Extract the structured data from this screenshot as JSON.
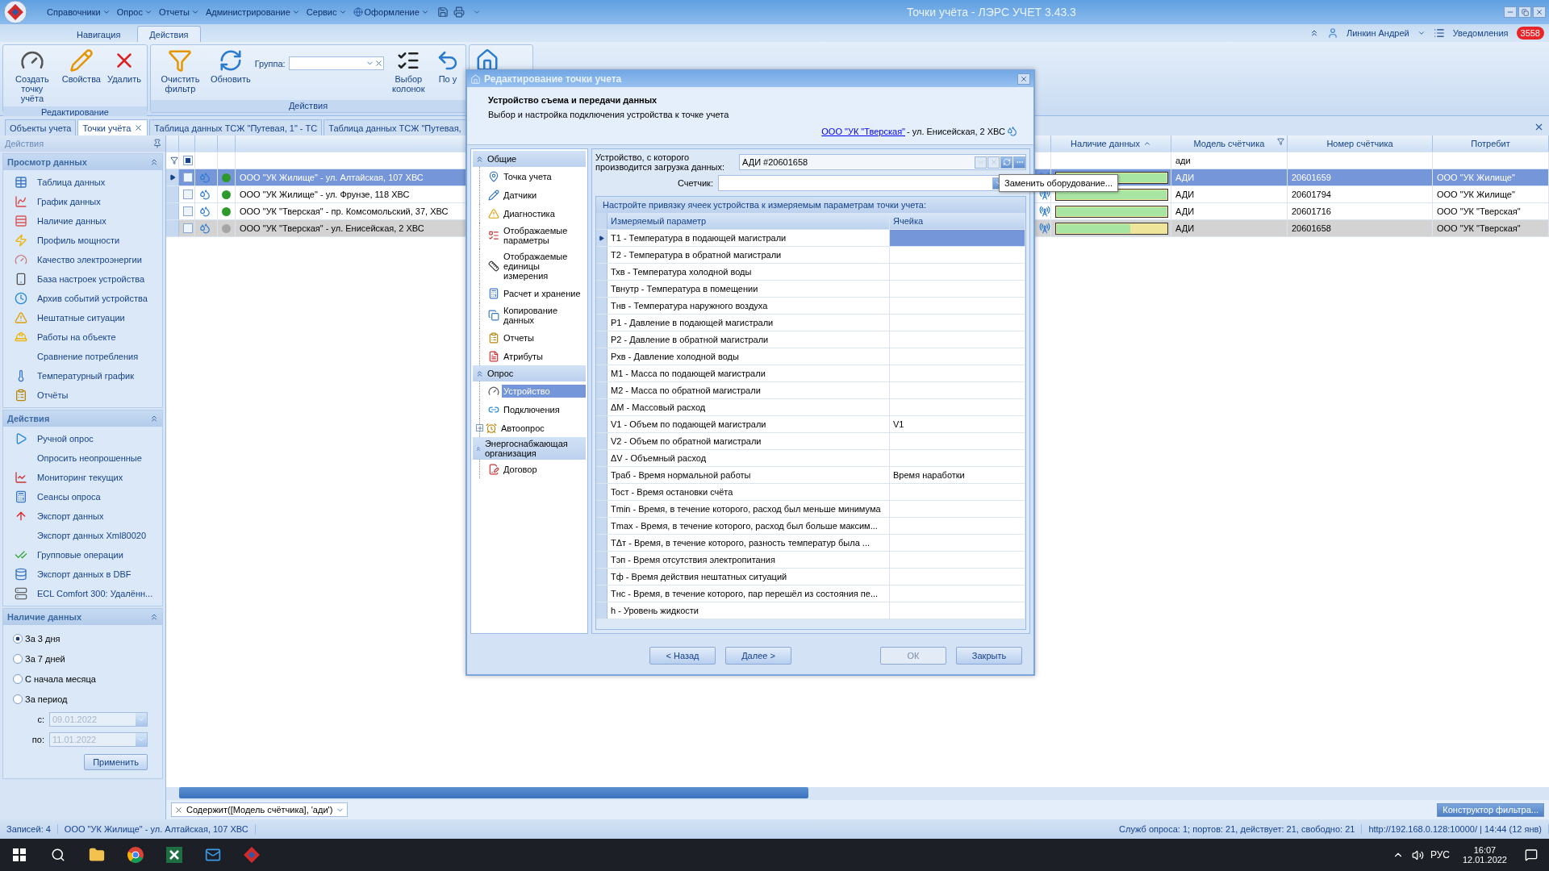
{
  "app": {
    "title": "Точки учёта - ЛЭРС УЧЕТ 3.43.3",
    "menu": [
      {
        "label": "Справочники"
      },
      {
        "label": "Опрос"
      },
      {
        "label": "Отчеты"
      },
      {
        "label": "Администрирование"
      },
      {
        "label": "Сервис"
      },
      {
        "label": "Оформление"
      }
    ],
    "user": "Линкин Андрей",
    "notifications": {
      "label": "Уведомления",
      "count": "3558"
    }
  },
  "ribbon": {
    "tabs": [
      {
        "label": "Навигация",
        "selected": false
      },
      {
        "label": "Действия",
        "selected": true
      }
    ],
    "groups": [
      {
        "title": "Редактирование",
        "items": [
          {
            "kind": "button",
            "label": "Создать точку учёта"
          },
          {
            "kind": "button",
            "label": "Свойства"
          },
          {
            "kind": "button",
            "label": "Удалить"
          }
        ]
      },
      {
        "title": "Действия",
        "items": [
          {
            "kind": "button",
            "label": "Очистить фильтр"
          },
          {
            "kind": "button",
            "label": "Обновить"
          },
          {
            "kind": "field",
            "label": "Группа:"
          },
          {
            "kind": "button",
            "label": "Выбор колонок"
          },
          {
            "kind": "button",
            "label": "По у"
          }
        ]
      },
      {
        "items": [
          {
            "kind": "icon"
          }
        ]
      }
    ]
  },
  "doc_tabs": [
    {
      "label": "Объекты учета",
      "selected": false,
      "closable": false
    },
    {
      "label": "Точки учёта",
      "selected": true,
      "closable": true
    },
    {
      "label": "Таблица данных ТСЖ \"Путевая, 1\" - ТС",
      "selected": false,
      "closable": false
    },
    {
      "label": "Таблица данных ТСЖ \"Путевая,",
      "selected": false,
      "closable": false
    }
  ],
  "sidebar": {
    "header": "Действия",
    "sections": [
      {
        "title": "Просмотр данных",
        "items": [
          "Таблица данных",
          "График данных",
          "Наличие данных",
          "Профиль мощности",
          "Качество электроэнергии",
          "База настроек устройства",
          "Архив событий устройства",
          "Нештатные ситуации",
          "Работы на объекте",
          "Сравнение потребления",
          "Температурный график",
          "Отчёты"
        ]
      },
      {
        "title": "Действия",
        "items": [
          "Ручной опрос",
          "Опросить неопрошенные",
          "Мониторинг текущих",
          "Сеансы опроса",
          "Экспорт данных",
          "Экспорт данных Xml80020",
          "Групповые операции",
          "Экспорт данных в DBF",
          "ECL Comfort 300: Удалённ..."
        ]
      }
    ],
    "availability": {
      "title": "Наличие данных",
      "options": [
        {
          "label": "За 3 дня",
          "selected": true
        },
        {
          "label": "За 7 дней",
          "selected": false
        },
        {
          "label": "С начала месяца",
          "selected": false
        },
        {
          "label": "За период",
          "selected": false
        }
      ],
      "from": {
        "label": "с:",
        "value": "09.01.2022",
        "disabled": true
      },
      "to": {
        "label": "по:",
        "value": "11.01.2022",
        "disabled": true
      },
      "apply": "Применить"
    }
  },
  "grid": {
    "columns": [
      {
        "label": "Наличие данных",
        "sorted": true,
        "filter": false
      },
      {
        "label": "Модель счётчика",
        "sorted": false,
        "filter": true
      },
      {
        "label": "Номер счётчика",
        "sorted": false,
        "filter": false
      },
      {
        "label": "Потребит",
        "sorted": false,
        "filter": false
      }
    ],
    "select_all_partial": true,
    "filter_model": "ади",
    "rows": [
      {
        "name": "ООО \"УК Жилище\" - ул. Алтайская, 107 ХВС",
        "color": "#2e9a2e",
        "selected": true,
        "current": false,
        "level": 1,
        "model": "АДИ",
        "number": "20601659",
        "checked": false,
        "consumer": "ООО \"УК Жилище\""
      },
      {
        "name": "ООО \"УК Жилище\" - ул. Фрунзе, 118 ХВС",
        "color": "#2e9a2e",
        "selected": false,
        "current": false,
        "level": 1,
        "model": "АДИ",
        "number": "20601794",
        "checked": false,
        "consumer": "ООО \"УК Жилище\""
      },
      {
        "name": "ООО \"УК \"Тверская\" - пр. Комсомольский, 37, ХВС",
        "color": "#2e9a2e",
        "selected": false,
        "current": false,
        "level": 1,
        "model": "АДИ",
        "number": "20601716",
        "checked": false,
        "consumer": "ООО \"УК \"Тверская\""
      },
      {
        "name": "ООО \"УК \"Тверская\" - ул. Енисейская, 2 ХВС",
        "color": "#a6a6a6",
        "selected": false,
        "current": true,
        "level": 0.67,
        "model": "АДИ",
        "number": "20601658",
        "checked": false,
        "consumer": "ООО \"УК \"Тверская\""
      }
    ],
    "filter_text": "Содержит([Модель счётчика], 'ади')",
    "filter_builder": "Конструктор фильтра..."
  },
  "status_bar": {
    "records": "Записей: 4",
    "current": "ООО \"УК Жилище\" - ул. Алтайская, 107 ХВС",
    "services": "Служб опроса: 1; портов: 21, действует: 21, свободно: 21",
    "server": "http://192.168.0.128:10000/ | 14:44 (12 янв)"
  },
  "taskbar": {
    "language": "РУС",
    "time": "16:07",
    "date": "12.01.2022"
  },
  "dialog": {
    "title": "Редактирование точки учета",
    "heading": "Устройство съема и передачи данных",
    "subheading": "Выбор и настройка подключения устройства к точке учета",
    "link": "ООО \"УК \"Тверская\"",
    "location": " - ул. Енисейская, 2 ХВС",
    "nav": [
      {
        "title": "Общие",
        "items": [
          {
            "label": "Точка учета",
            "selected": false,
            "expandable": false
          },
          {
            "label": "Датчики",
            "selected": false,
            "expandable": false
          },
          {
            "label": "Диагностика",
            "selected": false,
            "expandable": false
          },
          {
            "label": "Отображаемые параметры",
            "selected": false,
            "expandable": false
          },
          {
            "label": "Отображаемые единицы измерения",
            "selected": false,
            "expandable": false
          },
          {
            "label": "Расчет и хранение",
            "selected": false,
            "expandable": false
          },
          {
            "label": "Копирование данных",
            "selected": false,
            "expandable": false
          },
          {
            "label": "Отчеты",
            "selected": false,
            "expandable": false
          },
          {
            "label": "Атрибуты",
            "selected": false,
            "expandable": false
          }
        ]
      },
      {
        "title": "Опрос",
        "items": [
          {
            "label": "Устройство",
            "selected": true,
            "expandable": false
          },
          {
            "label": "Подключения",
            "selected": false,
            "expandable": false
          },
          {
            "label": "Автоопрос",
            "selected": false,
            "expandable": true
          }
        ]
      },
      {
        "title": "Энергоснабжающая организация",
        "items": [
          {
            "label": "Договор",
            "selected": false,
            "expandable": false
          }
        ]
      }
    ],
    "device_label": "Устройство, с которого производится загрузка данных:",
    "device_value": "АДИ #20601658",
    "meter_label": "Счетчик:",
    "mapping_title": "Настройте привязку ячеек устройства к измеряемым параметрам точки учета:",
    "columns": [
      "Измеряемый параметр",
      "Ячейка"
    ],
    "params": [
      {
        "name": "Т1 - Температура в подающей магистрали",
        "selected": true
      },
      {
        "name": "Т2 - Температура в обратной магистрали",
        "selected": false
      },
      {
        "name": "Тхв - Температура холодной воды",
        "selected": false
      },
      {
        "name": "Твнутр - Температура в помещении",
        "selected": false
      },
      {
        "name": "Тнв - Температура наружного воздуха",
        "selected": false
      },
      {
        "name": "Р1 - Давление в подающей магистрали",
        "selected": false
      },
      {
        "name": "Р2 - Давление в обратной магистрали",
        "selected": false
      },
      {
        "name": "Рхв - Давление холодной воды",
        "selected": false
      },
      {
        "name": "М1 - Масса по подающей магистрали",
        "selected": false
      },
      {
        "name": "М2 - Масса по обратной магистрали",
        "selected": false
      },
      {
        "name": "ΔМ - Массовый расход",
        "selected": false
      },
      {
        "name": "V1 - Объем по подающей магистрали",
        "cell": "V1",
        "selected": false
      },
      {
        "name": "V2 - Объем по обратной магистрали",
        "selected": false
      },
      {
        "name": "ΔV - Объемный расход",
        "selected": false
      },
      {
        "name": "Траб - Время нормальной работы",
        "cell": "Время наработки",
        "selected": false
      },
      {
        "name": "Тост - Время остановки счёта",
        "selected": false
      },
      {
        "name": "Tmin - Время, в течение которого, расход был меньше минимума",
        "selected": false
      },
      {
        "name": "Tmax - Время, в течение которого, расход был больше максим...",
        "selected": false
      },
      {
        "name": "ТΔт - Время, в течение которого, разность температур была ...",
        "selected": false
      },
      {
        "name": "Тэп - Время отсутствия электропитания",
        "selected": false
      },
      {
        "name": "Тф - Время действия нештатных ситуаций",
        "selected": false
      },
      {
        "name": "Тнс - Время, в течение которого, пар перешёл из состояния пе...",
        "selected": false
      },
      {
        "name": "h - Уровень жидкости",
        "selected": false
      }
    ],
    "buttons": [
      {
        "label": "< Назад",
        "disabled": false
      },
      {
        "label": "Далее >",
        "disabled": false
      },
      {
        "label": "ОК",
        "disabled": true
      },
      {
        "label": "Закрыть",
        "disabled": false
      }
    ],
    "tooltip": "Заменить оборудование..."
  }
}
